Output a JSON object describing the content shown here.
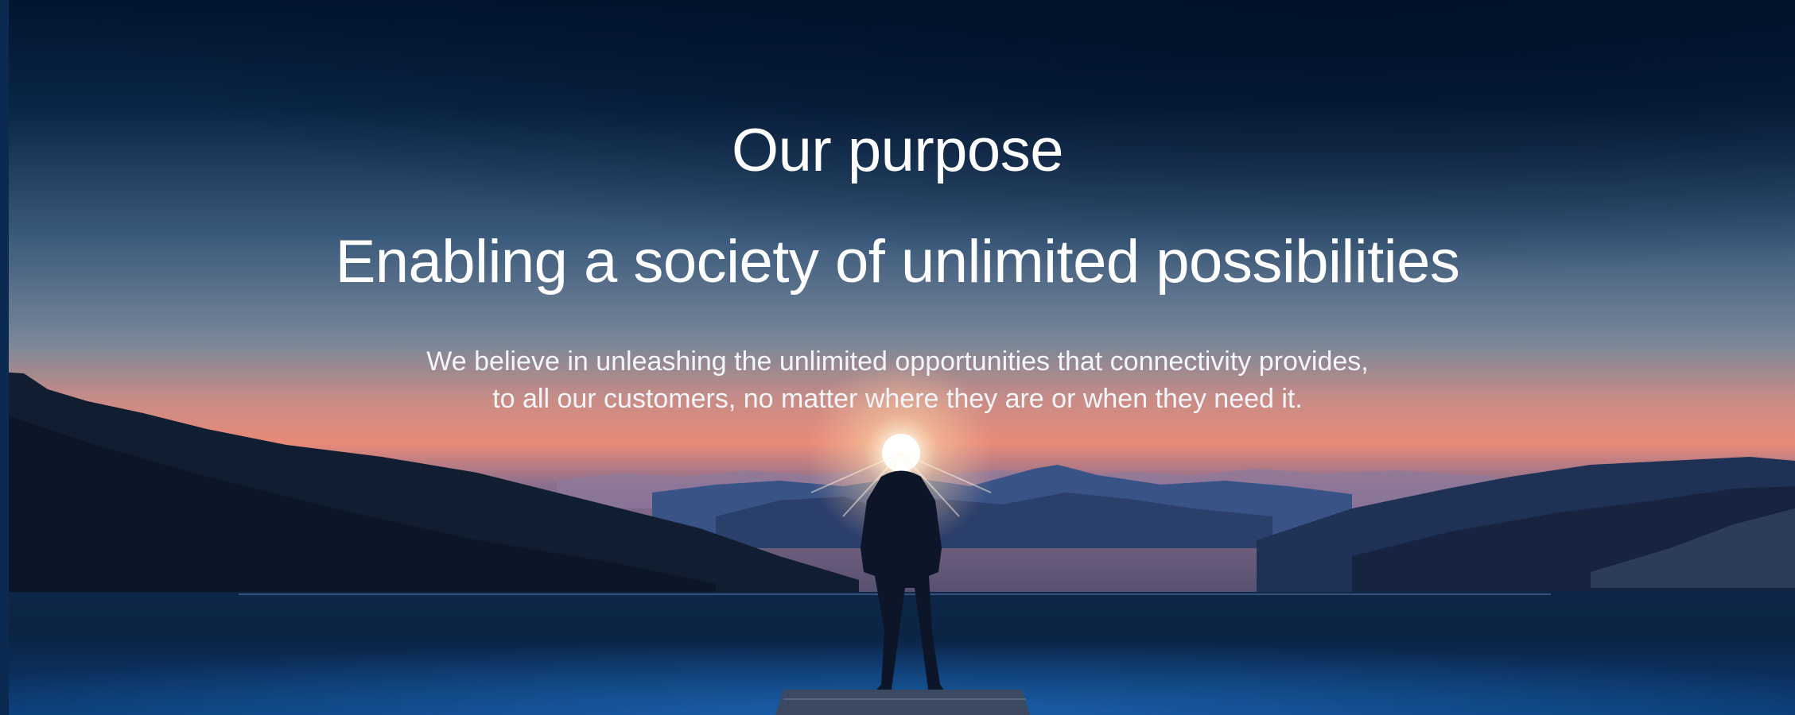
{
  "hero": {
    "title": "Our purpose",
    "headline": "Enabling a society of unlimited possibilities",
    "body_line_1": "We believe in unleashing the unlimited opportunities that connectivity provides,",
    "body_line_2": "to all our customers, no matter where they are or when they need it."
  },
  "colors": {
    "sky_top": "#02152f",
    "sky_mid": "#3b5f82",
    "horizon_glow": "#e48b7c",
    "text": "#ffffff"
  }
}
